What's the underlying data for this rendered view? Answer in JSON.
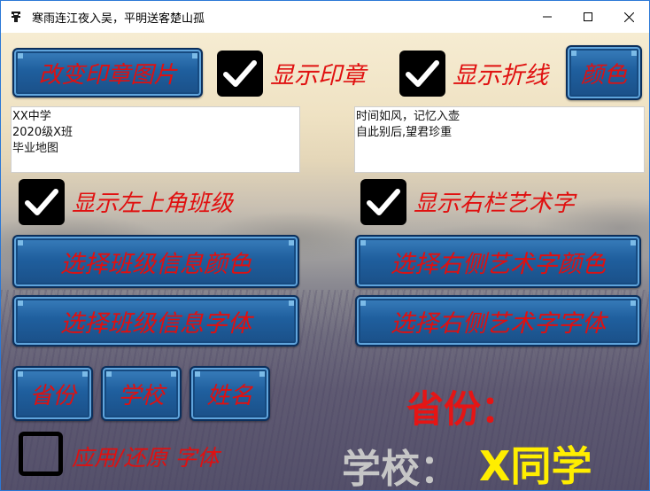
{
  "window": {
    "title": "寒雨连江夜入吴，平明送客楚山孤",
    "icon": "app-logo-icon",
    "controls": [
      "minimize-icon",
      "maximize-icon",
      "close-icon"
    ]
  },
  "top_row": {
    "change_seal_label": "改变印章图片",
    "show_seal": {
      "label": "显示印章",
      "checked": true
    },
    "show_polyline": {
      "label": "显示折线",
      "checked": true
    },
    "color_label": "颜色"
  },
  "class_info_box": {
    "lines": [
      "XX中学",
      "2020级X班",
      "毕业地图"
    ]
  },
  "art_text_box": {
    "lines": [
      "时间如风，记忆入壶",
      "自此别后,望君珍重"
    ]
  },
  "toggles": {
    "show_top_left_class": {
      "label": "显示左上角班级",
      "checked": true
    },
    "show_right_art_text": {
      "label": "显示右栏艺术字",
      "checked": true
    }
  },
  "buttons": {
    "class_info_color": "选择班级信息颜色",
    "right_art_color": "选择右侧艺术字颜色",
    "class_info_font": "选择班级信息字体",
    "right_art_font": "选择右侧艺术字字体",
    "province": "省份",
    "school": "学校",
    "name": "姓名"
  },
  "apply_font": {
    "label": "应用/还原 字体",
    "checked": false
  },
  "preview": {
    "province": "省份：",
    "school": "学校：",
    "student": "X同学"
  },
  "colors": {
    "label_red": "#e01010",
    "button_blue": "#1f5f9e",
    "preview_red": "#e51515",
    "preview_gray": "#c6c6c6",
    "preview_yellow": "#ffee00"
  }
}
